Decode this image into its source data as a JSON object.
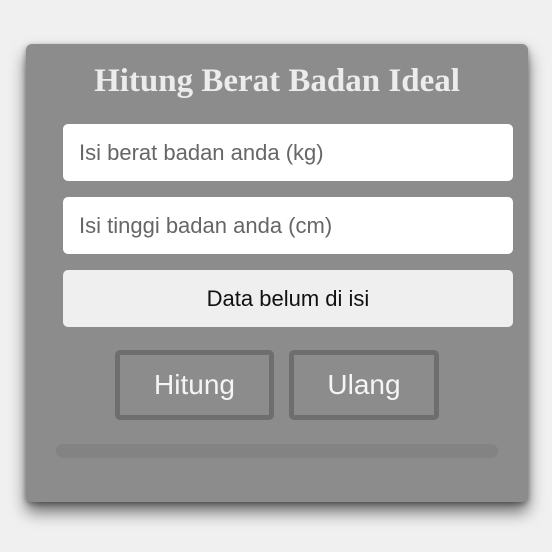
{
  "app": {
    "title": "Hitung Berat Badan Ideal"
  },
  "form": {
    "weight": {
      "value": "",
      "placeholder": "Isi berat badan anda (kg)"
    },
    "height": {
      "value": "",
      "placeholder": "Isi tinggi badan anda (cm)"
    },
    "result_text": "Data belum di isi"
  },
  "buttons": {
    "calculate_label": "Hitung",
    "reset_label": "Ulang"
  },
  "progress": {
    "percent": 0
  },
  "colors": {
    "page_background": "#f0f0f0",
    "card_background": "#8c8c8c",
    "button_border": "#6e6e6e",
    "title_text": "#ececec"
  }
}
